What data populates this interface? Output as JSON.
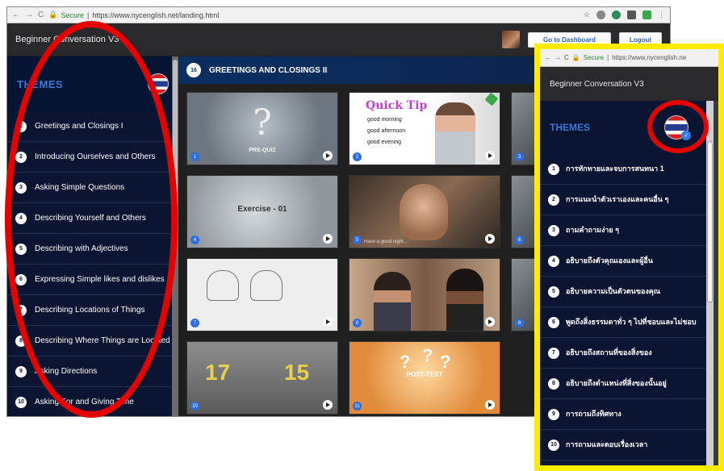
{
  "browser": {
    "secure_label": "Secure",
    "url": "https://www.nycenglish.net/landing.html"
  },
  "app": {
    "title": "Beginner Conversation V3",
    "dashboard_button": "Go to Dashboard",
    "logout_button": "Logout"
  },
  "sidebar": {
    "heading": "THEMES",
    "items": [
      {
        "num": "1",
        "label": "Greetings and Closings I"
      },
      {
        "num": "2",
        "label": "Introducing Ourselves and Others"
      },
      {
        "num": "3",
        "label": "Asking Simple Questions"
      },
      {
        "num": "4",
        "label": "Describing Yourself and Others"
      },
      {
        "num": "5",
        "label": "Describing with Adjectives"
      },
      {
        "num": "6",
        "label": "Expressing Simple likes and dislikes"
      },
      {
        "num": "7",
        "label": "Describing Locations of Things"
      },
      {
        "num": "8",
        "label": "Describing Where Things are Located"
      },
      {
        "num": "9",
        "label": "Asking Directions"
      },
      {
        "num": "10",
        "label": "Asking For and Giving Time"
      }
    ]
  },
  "lesson": {
    "number": "16",
    "title": "GREETINGS AND CLOSINGS II",
    "tiles": [
      {
        "num": "1",
        "caption": "PRE-QUIZ"
      },
      {
        "num": "2",
        "tip_title": "Quick Tip",
        "lines": [
          "good morning",
          "good afternoon",
          "good evening"
        ]
      },
      {
        "num": "3"
      },
      {
        "num": "4",
        "caption": "Exercise - 01"
      },
      {
        "num": "5",
        "subtitle": "Have a good night..."
      },
      {
        "num": "6"
      },
      {
        "num": "7"
      },
      {
        "num": "8"
      },
      {
        "num": "9"
      },
      {
        "num": "10",
        "left_score": "17",
        "right_score": "15"
      },
      {
        "num": "11",
        "caption": "POST-TEST"
      }
    ]
  },
  "mobile": {
    "secure_label": "Secure",
    "url": "https://www.nycenglish.ne",
    "title": "Beginner Conversation V3",
    "heading": "THEMES",
    "items": [
      {
        "num": "1",
        "label": "การทักทายและจบการสนทนา 1"
      },
      {
        "num": "2",
        "label": "การแนะนำตัวเราเองและคนอื่น ๆ"
      },
      {
        "num": "3",
        "label": "ถามคำถามง่าย ๆ"
      },
      {
        "num": "4",
        "label": "อธิบายถึงตัวคุณเองและผู้อื่น"
      },
      {
        "num": "5",
        "label": "อธิบายความเป็นตัวตนของคุณ"
      },
      {
        "num": "6",
        "label": "พูดถึงสิ่งธรรมดาทั่ว ๆ ไปที่ชอบและไม่ชอบ"
      },
      {
        "num": "7",
        "label": "อธิบายถึงสถานที่ของสิ่งของ"
      },
      {
        "num": "8",
        "label": "อธิบายถึงตำแหน่งที่สิ่งของนั้นอยู่"
      },
      {
        "num": "9",
        "label": "การถามถึงทิศทาง"
      },
      {
        "num": "10",
        "label": "การถามและตอบเรื่องเวลา"
      }
    ]
  },
  "colors": {
    "highlight_red": "#e60000",
    "highlight_yellow": "#ffec00",
    "themes_blue": "#3a78d8",
    "sidebar_bg": "#0b1430"
  }
}
